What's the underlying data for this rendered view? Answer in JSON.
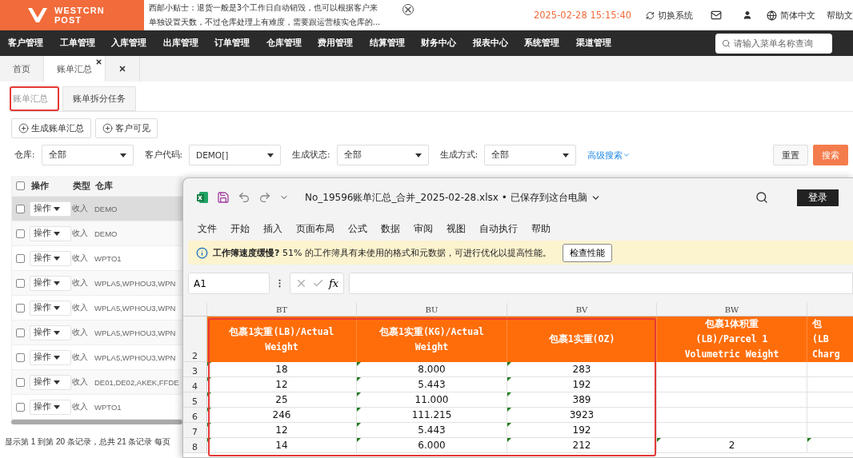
{
  "header": {
    "logo": [
      "WESTCRN",
      "POST"
    ],
    "tip": [
      "西邮小贴士：退货一般是3个工作日自动销毁，也可以根据客户来",
      "单独设置天数，不过仓库处理上有难度，需要跟运营核实仓库的..."
    ],
    "datetime": "2025-02-28 15:15:40",
    "switch_system": "切换系统",
    "language": "简体中文",
    "help": "帮助文"
  },
  "nav": {
    "items": [
      "客户管理",
      "工单管理",
      "入库管理",
      "出库管理",
      "订单管理",
      "仓库管理",
      "费用管理",
      "结算管理",
      "财务中心",
      "报表中心",
      "系统管理",
      "渠道管理"
    ],
    "search_placeholder": "请输入菜单名称查询"
  },
  "page_tabs": [
    {
      "label": "首页",
      "selected": false,
      "closable": false
    },
    {
      "label": "账单汇总",
      "selected": true,
      "closable": true
    },
    {
      "selected": false,
      "closable": true
    }
  ],
  "sub_tabs": [
    {
      "label": "账单汇总",
      "selected": true
    },
    {
      "label": "账单拆分任务",
      "selected": false
    }
  ],
  "actions": [
    "生成账单汇总",
    "客户可见"
  ],
  "filters": [
    {
      "label": "仓库:",
      "value": "全部"
    },
    {
      "label": "客户代码:",
      "value": "DEMO[]"
    },
    {
      "label": "生成状态:",
      "value": "全部"
    },
    {
      "label": "生成方式:",
      "value": "全部"
    }
  ],
  "advanced_search": "高级搜索",
  "reset": "重置",
  "search": "搜索",
  "table": {
    "select_all_checked": false,
    "columns": [
      "操作",
      "类型",
      "仓库"
    ],
    "rows": [
      {
        "checked": false,
        "action": "操作",
        "type": "收入",
        "warehouse": "DEMO",
        "highlighted": true
      },
      {
        "checked": false,
        "action": "操作",
        "type": "收入",
        "warehouse": "DEMO",
        "highlighted": false
      },
      {
        "checked": false,
        "action": "操作",
        "type": "收入",
        "warehouse": "WPTO1",
        "highlighted": false
      },
      {
        "checked": false,
        "action": "操作",
        "type": "收入",
        "warehouse": "WPLA5,WPHOU3,WPN",
        "highlighted": false
      },
      {
        "checked": false,
        "action": "操作",
        "type": "收入",
        "warehouse": "WPLA5,WPHOU3,WPN",
        "highlighted": false
      },
      {
        "checked": false,
        "action": "操作",
        "type": "收入",
        "warehouse": "WPLA5,WPHOU3,WPN",
        "highlighted": false
      },
      {
        "checked": false,
        "action": "操作",
        "type": "收入",
        "warehouse": "WPLA5,WPHOU3,WPN",
        "highlighted": false
      },
      {
        "checked": false,
        "action": "操作",
        "type": "收入",
        "warehouse": "DE01,DE02,AKEK,FFDE",
        "highlighted": false
      },
      {
        "checked": false,
        "action": "操作",
        "type": "收入",
        "warehouse": "WPTO1",
        "highlighted": false
      }
    ],
    "pagination": "显示第 1 到第 20 条记录，总共 21 条记录 每页"
  },
  "excel": {
    "filename": "No_19596账单汇总_合并_2025-02-28.xlsx • 已保存到这台电脑",
    "login": "登录",
    "menu": [
      "文件",
      "开始",
      "插入",
      "页面布局",
      "公式",
      "数据",
      "审阅",
      "视图",
      "自动执行",
      "帮助"
    ],
    "notice": "**工作簿速度缓慢?** 51% 的工作簿具有未使用的格式和元数据，可进行优化以提高性能。",
    "notice_button": "检查性能",
    "name_box": "A1",
    "fx": "fx",
    "columns": [
      "BT",
      "BU",
      "BV",
      "BW",
      ""
    ],
    "header_row": "2",
    "headers": [
      [
        "包裹1实重(LB)/Actual",
        "Weight"
      ],
      [
        "包裹1实重(KG)/Actual",
        "Weight"
      ],
      [
        "包裹1实重(OZ)"
      ],
      [
        "包裹1体积重",
        "(LB)/Parcel 1",
        "Volumetric Weight"
      ],
      [
        "包",
        "(LB",
        "Charg"
      ]
    ],
    "rows": [
      {
        "number": "3",
        "cells": [
          {
            "text": "18",
            "flag": true
          },
          {
            "text": "8.000",
            "flag": true
          },
          {
            "text": "283",
            "flag": true
          },
          {
            "text": "",
            "flag": false
          },
          {
            "text": "",
            "flag": false
          }
        ]
      },
      {
        "number": "4",
        "cells": [
          {
            "text": "12",
            "flag": true
          },
          {
            "text": "5.443",
            "flag": true
          },
          {
            "text": "192",
            "flag": true
          },
          {
            "text": "",
            "flag": false
          },
          {
            "text": "",
            "flag": false
          }
        ]
      },
      {
        "number": "5",
        "cells": [
          {
            "text": "25",
            "flag": true
          },
          {
            "text": "11.000",
            "flag": true
          },
          {
            "text": "389",
            "flag": true
          },
          {
            "text": "",
            "flag": false
          },
          {
            "text": "",
            "flag": false
          }
        ]
      },
      {
        "number": "6",
        "cells": [
          {
            "text": "246",
            "flag": true
          },
          {
            "text": "111.215",
            "flag": true
          },
          {
            "text": "3923",
            "flag": true
          },
          {
            "text": "",
            "flag": false
          },
          {
            "text": "",
            "flag": false
          }
        ]
      },
      {
        "number": "7",
        "cells": [
          {
            "text": "12",
            "flag": true
          },
          {
            "text": "5.443",
            "flag": true
          },
          {
            "text": "192",
            "flag": true
          },
          {
            "text": "",
            "flag": false
          },
          {
            "text": "",
            "flag": false
          }
        ]
      },
      {
        "number": "8",
        "cells": [
          {
            "text": "14",
            "flag": true
          },
          {
            "text": "6.000",
            "flag": true
          },
          {
            "text": "212",
            "flag": true
          },
          {
            "text": "2",
            "flag": true
          },
          {
            "text": "",
            "flag": true
          }
        ]
      }
    ]
  }
}
